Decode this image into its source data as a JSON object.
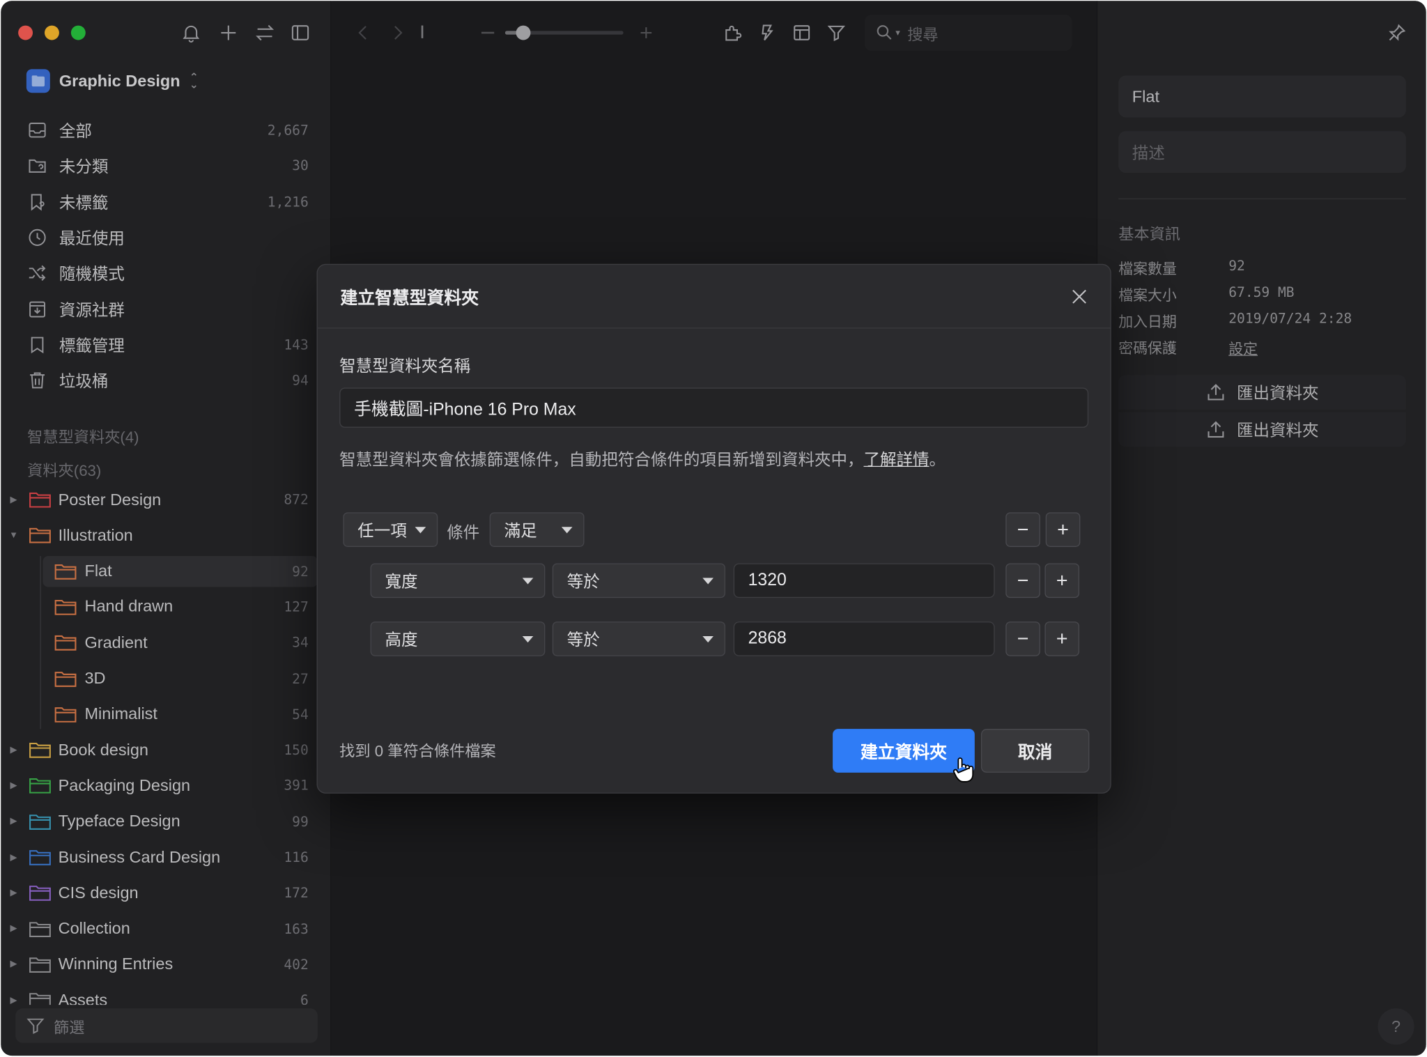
{
  "colors": {
    "accent": "#2f7cf6",
    "traffic_red": "#fe5f57",
    "traffic_yellow": "#febc2e",
    "traffic_green": "#28c840"
  },
  "library": {
    "name": "Graphic Design"
  },
  "nav": [
    {
      "label": "全部",
      "count": "2,667",
      "icon": "inbox-icon"
    },
    {
      "label": "未分類",
      "count": "30",
      "icon": "unfiled-folder-icon"
    },
    {
      "label": "未標籤",
      "count": "1,216",
      "icon": "untagged-icon"
    },
    {
      "label": "最近使用",
      "count": "",
      "icon": "clock-icon"
    },
    {
      "label": "隨機模式",
      "count": "",
      "icon": "shuffle-icon"
    },
    {
      "label": "資源社群",
      "count": "",
      "icon": "community-icon"
    },
    {
      "label": "標籤管理",
      "count": "143",
      "icon": "bookmark-icon"
    },
    {
      "label": "垃圾桶",
      "count": "94",
      "icon": "trash-icon"
    }
  ],
  "sections": {
    "smart_folders": "智慧型資料夾(4)",
    "folders": "資料夾(63)"
  },
  "folders": [
    {
      "label": "Poster Design",
      "count": "872",
      "color": "#e5484d"
    },
    {
      "label": "Illustration",
      "count": "",
      "color": "#e5804d"
    },
    {
      "label": "Flat",
      "count": "92",
      "color": "#e5804d"
    },
    {
      "label": "Hand drawn",
      "count": "127",
      "color": "#e5804d"
    },
    {
      "label": "Gradient",
      "count": "34",
      "color": "#e5804d"
    },
    {
      "label": "3D",
      "count": "27",
      "color": "#e5804d"
    },
    {
      "label": "Minimalist",
      "count": "54",
      "color": "#e5804d"
    },
    {
      "label": "Book design",
      "count": "150",
      "color": "#e5b64d"
    },
    {
      "label": "Packaging Design",
      "count": "391",
      "color": "#3fb950"
    },
    {
      "label": "Typeface Design",
      "count": "99",
      "color": "#3fa7c9"
    },
    {
      "label": "Business Card Design",
      "count": "116",
      "color": "#3f7fd9"
    },
    {
      "label": "CIS design",
      "count": "172",
      "color": "#9a6ddb"
    },
    {
      "label": "Collection",
      "count": "163",
      "color": "#9a9a9e"
    },
    {
      "label": "Winning Entries",
      "count": "402",
      "color": "#9a9a9e"
    },
    {
      "label": "Assets",
      "count": "6",
      "color": "#9a9a9e"
    }
  ],
  "sidebar_filter": "篩選",
  "toolbar": {
    "search_placeholder": "搜尋",
    "zoom_level": 0.15
  },
  "inspector": {
    "name_value": "Flat",
    "desc_placeholder": "描述",
    "section_title": "基本資訊",
    "rows": [
      {
        "label": "檔案數量",
        "value": "92"
      },
      {
        "label": "檔案大小",
        "value": "67.59 MB"
      },
      {
        "label": "加入日期",
        "value": "2019/07/24 2:28"
      },
      {
        "label": "密碼保護",
        "value": "設定"
      }
    ],
    "export_1": "匯出資料夾",
    "export_2": "匯出資料夾"
  },
  "dialog": {
    "title": "建立智慧型資料夾",
    "name_label": "智慧型資料夾名稱",
    "name_value": "手機截圖-iPhone 16 Pro Max",
    "desc_prefix": "智慧型資料夾會依據篩選條件，自動把符合條件的項目新增到資料夾中，",
    "desc_link": "了解詳情",
    "desc_suffix": "。",
    "match_mode": "任一項",
    "condition_label": "條件",
    "match_rule": "滿足",
    "rules": [
      {
        "field": "寬度",
        "operator": "等於",
        "value": "1320"
      },
      {
        "field": "高度",
        "operator": "等於",
        "value": "2868"
      }
    ],
    "found_text": "找到 0 筆符合條件檔案",
    "create_label": "建立資料夾",
    "cancel_label": "取消",
    "minus": "−",
    "plus": "+"
  },
  "help": "?"
}
